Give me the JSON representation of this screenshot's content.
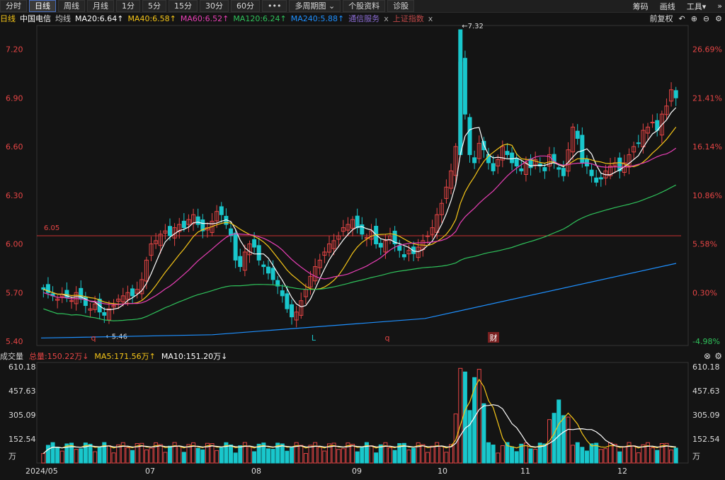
{
  "toolbar": {
    "tabs": [
      "分时",
      "日线",
      "周线",
      "月线",
      "1分",
      "5分",
      "15分",
      "30分",
      "60分",
      "•••",
      "多周期图 ⌄",
      "个股资料",
      "诊股"
    ],
    "active_index": 1,
    "right_items": [
      "筹码",
      "画线",
      "工具▾"
    ],
    "right_icon": "double-chevron-right-icon"
  },
  "stock": {
    "period": "日线",
    "name": "中国电信",
    "ma_label": "均线",
    "ma20": "MA20:6.64↑",
    "ma40": "MA40:6.58↑",
    "ma60": "MA60:6.52↑",
    "ma120": "MA120:6.24↑",
    "ma240": "MA240:5.88↑",
    "tag1": "通信服务",
    "tag1_close": "x",
    "tag2": "上证指数",
    "tag2_close": "x",
    "adjust": "前复权"
  },
  "colors": {
    "up": "#e64545",
    "down": "#19c7cc",
    "ma20": "#ffffff",
    "ma40": "#f5c518",
    "ma60": "#e83fb5",
    "ma120": "#2fc25b",
    "ma240": "#1e90ff"
  },
  "price_axis": {
    "labels": [
      "7.20",
      "6.90",
      "6.60",
      "6.30",
      "6.00",
      "5.70",
      "5.40"
    ],
    "values": [
      7.2,
      6.9,
      6.6,
      6.3,
      6.0,
      5.7,
      5.4
    ]
  },
  "pct_axis": [
    "26.69%",
    "21.41%",
    "16.14%",
    "10.86%",
    "5.58%",
    "0.30%",
    "-4.98%"
  ],
  "annotations": {
    "max": "←7.32",
    "min": "←5.46",
    "hline": "6.05",
    "markers": [
      "q",
      "L",
      "q",
      "财"
    ]
  },
  "volume": {
    "title": "成交量",
    "total": "总量:150.22万↓",
    "ma5": "MA5:171.56万↑",
    "ma10": "MA10:151.20万↓",
    "axis": [
      "610.18",
      "457.63",
      "305.09",
      "152.54",
      "万"
    ]
  },
  "x_labels": [
    "2024/05",
    "07",
    "08",
    "09",
    "10",
    "11",
    "12"
  ],
  "chart_data": {
    "type": "candlestick",
    "xlabels": [
      "2024/05",
      "07",
      "08",
      "09",
      "10",
      "11",
      "12"
    ],
    "ylim": [
      5.4,
      7.32
    ],
    "reference_line": 6.05,
    "high": 7.32,
    "low": 5.46,
    "ma": {
      "MA20": 6.64,
      "MA40": 6.58,
      "MA60": 6.52,
      "MA120": 6.24,
      "MA240": 5.88
    },
    "close": [
      5.72,
      5.7,
      5.68,
      5.66,
      5.69,
      5.67,
      5.65,
      5.7,
      5.66,
      5.62,
      5.6,
      5.63,
      5.58,
      5.56,
      5.6,
      5.62,
      5.66,
      5.68,
      5.7,
      5.68,
      5.72,
      5.78,
      5.9,
      6.0,
      6.02,
      6.06,
      6.08,
      6.05,
      6.1,
      6.12,
      6.1,
      6.15,
      6.18,
      6.12,
      6.08,
      6.1,
      6.14,
      6.2,
      6.18,
      6.12,
      6.05,
      5.9,
      5.86,
      5.95,
      6.0,
      5.98,
      5.9,
      5.86,
      5.82,
      5.78,
      5.74,
      5.68,
      5.6,
      5.55,
      5.58,
      5.65,
      5.72,
      5.8,
      5.86,
      5.9,
      5.95,
      6.0,
      6.02,
      6.05,
      6.1,
      6.12,
      6.15,
      6.1,
      6.06,
      6.04,
      6.08,
      6.0,
      5.98,
      6.02,
      6.05,
      6.0,
      5.96,
      5.92,
      5.96,
      5.94,
      5.98,
      6.02,
      6.05,
      6.1,
      6.18,
      6.25,
      6.35,
      6.45,
      6.6,
      7.12,
      6.8,
      6.55,
      6.5,
      6.62,
      6.58,
      6.5,
      6.45,
      6.52,
      6.6,
      6.55,
      6.5,
      6.48,
      6.45,
      6.5,
      6.47,
      6.52,
      6.48,
      6.45,
      6.55,
      6.5,
      6.46,
      6.42,
      6.58,
      6.72,
      6.65,
      6.5,
      6.48,
      6.42,
      6.38,
      6.4,
      6.45,
      6.48,
      6.5,
      6.45,
      6.5,
      6.55,
      6.6,
      6.62,
      6.7,
      6.72,
      6.75,
      6.7,
      6.8,
      6.85,
      6.95,
      6.9
    ],
    "volume_unit": "万",
    "volume_ma5": 171.56,
    "volume_ma10": 151.2,
    "volume_total": 150.22,
    "volume_ylim": [
      0,
      610.18
    ]
  }
}
